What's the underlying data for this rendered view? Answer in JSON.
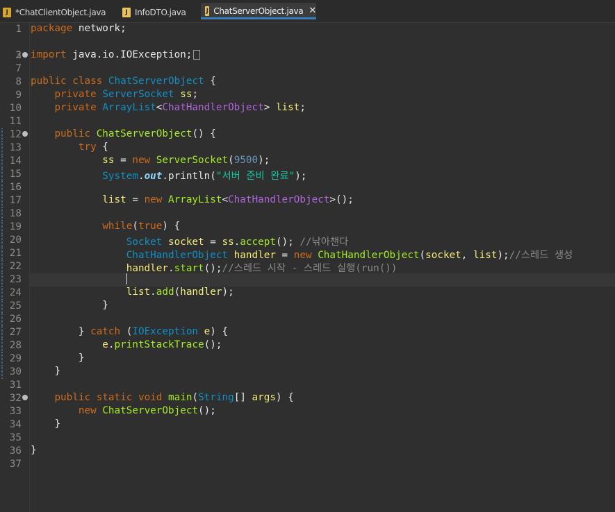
{
  "tabs": [
    {
      "label": "*ChatClientObject.java",
      "active": false
    },
    {
      "label": "InfoDTO.java",
      "active": false
    },
    {
      "label": "ChatServerObject.java",
      "active": true
    }
  ],
  "close_symbol": "✕",
  "code": {
    "line_numbers": [
      "1",
      "2",
      "3",
      "7",
      "8",
      "9",
      "10",
      "11",
      "12",
      "13",
      "14",
      "15",
      "16",
      "17",
      "18",
      "19",
      "20",
      "21",
      "22",
      "23",
      "24",
      "25",
      "26",
      "27",
      "28",
      "29",
      "30",
      "31",
      "32",
      "33",
      "34",
      "35",
      "36",
      "37"
    ],
    "l1": {
      "kw": "package",
      "rest": " network;"
    },
    "l3": {
      "kw": "import",
      "rest": " java.io.IOException;"
    },
    "l8": {
      "kw1": "public",
      "kw2": "class",
      "name": "ChatServerObject",
      "rest": " {"
    },
    "l9": {
      "kw": "private",
      "type": "ServerSocket",
      "var": "ss",
      "semi": ";"
    },
    "l10": {
      "kw": "private",
      "type": "ArrayList",
      "lt": "<",
      "generic": "ChatHandlerObject",
      "gt": ">",
      "var": "list",
      "semi": ";"
    },
    "l12": {
      "kw": "public",
      "name": "ChatServerObject",
      "rest": "() {"
    },
    "l13": {
      "kw": "try",
      "rest": " {"
    },
    "l14": {
      "var": "ss",
      "eq": " = ",
      "kw": "new",
      "type": "ServerSocket",
      "open": "(",
      "num": "9500",
      "close": ");"
    },
    "l15": {
      "type": "System",
      "dot": ".",
      "field": "out",
      "call": ".println(",
      "str": "\"서버 준비 완료\"",
      "close": ");"
    },
    "l17": {
      "var": "list",
      "eq": " = ",
      "kw": "new",
      "type": "ArrayList",
      "lt": "<",
      "generic": "ChatHandlerObject",
      "gt": ">",
      "close": "();"
    },
    "l19": {
      "kw": "while",
      "open": "(",
      "kw2": "true",
      "close": ") {"
    },
    "l20": {
      "type": "Socket",
      "var": "socket",
      "eq": " = ",
      "var2": "ss",
      "dot": ".",
      "method": "accept",
      "close": "(); ",
      "comment": "//낚아챈다"
    },
    "l21": {
      "type": "ChatHandlerObject",
      "var": "handler",
      "eq": " = ",
      "kw": "new",
      "type2": "ChatHandlerObject",
      "open": "(",
      "a1": "socket",
      "comma": ", ",
      "a2": "list",
      "close": ");",
      "comment": "//스레드 생성"
    },
    "l22": {
      "var": "handler",
      "dot": ".",
      "method": "start",
      "close": "();",
      "comment": "//스레드 시작 - 스레드 실행(run())"
    },
    "l24": {
      "var": "list",
      "dot": ".",
      "method": "add",
      "open": "(",
      "arg": "handler",
      "close": ");"
    },
    "brace_close": "}",
    "l27": {
      "pre": "} ",
      "kw": "catch",
      "open": " (",
      "type": "IOException",
      "var": "e",
      "close": ") {"
    },
    "l28": {
      "var": "e",
      "dot": ".",
      "method": "printStackTrace",
      "close": "();"
    },
    "l32": {
      "kw1": "public",
      "kw2": "static",
      "kw3": "void",
      "name": "main",
      "open": "(",
      "type": "String",
      "arr": "[] ",
      "var": "args",
      "close": ") {"
    },
    "l33": {
      "kw": "new",
      "name": "ChatServerObject",
      "close": "();"
    }
  },
  "colors": {
    "background": "#2f2f2f",
    "keyword": "#cc6c1d",
    "type": "#1290c3",
    "generic": "#b166da",
    "number": "#6897bb",
    "string": "#17c6a3",
    "method": "#a7ec21",
    "comment": "#8a8a8a",
    "variable": "#f3ec79",
    "tab_active_underline": "#3a7fc1"
  },
  "icons": {
    "java_file_icon": "J",
    "fold_marker": "circle-minus"
  }
}
